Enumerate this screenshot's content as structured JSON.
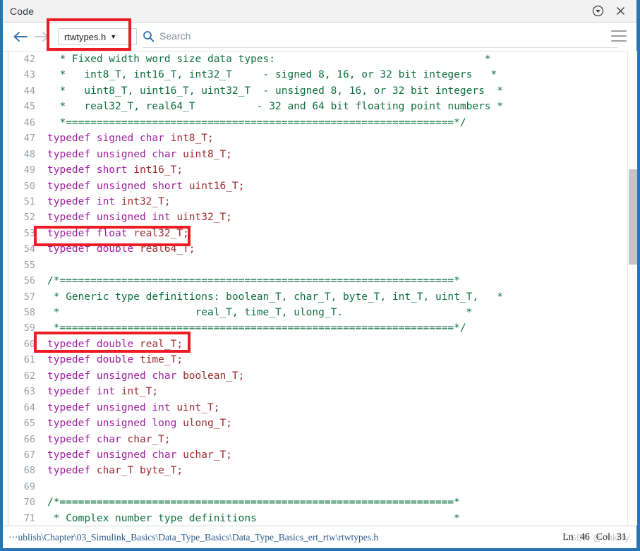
{
  "window": {
    "title": "Code",
    "undock_icon": "circle-down-arrow-icon",
    "close_icon": "close-icon"
  },
  "toolbar": {
    "back_icon": "arrow-left-icon",
    "forward_icon": "arrow-right-icon",
    "file_dropdown": {
      "value": "rtwtypes.h",
      "caret": "▼"
    },
    "search": {
      "icon": "search-icon",
      "placeholder": "Search",
      "value": ""
    },
    "menu_icon": "hamburger-menu-icon"
  },
  "editor": {
    "first_line": 42,
    "lines": [
      {
        "n": 42,
        "tokens": [
          {
            "t": "cm",
            "s": "  * Fixed width word size data types:                                  *"
          }
        ]
      },
      {
        "n": 43,
        "tokens": [
          {
            "t": "cm",
            "s": "  *   int8_T, int16_T, int32_T     - signed 8, 16, or 32 bit integers   *"
          }
        ]
      },
      {
        "n": 44,
        "tokens": [
          {
            "t": "cm",
            "s": "  *   uint8_T, uint16_T, uint32_T  - unsigned 8, 16, or 32 bit integers  *"
          }
        ]
      },
      {
        "n": 45,
        "tokens": [
          {
            "t": "cm",
            "s": "  *   real32_T, real64_T          - 32 and 64 bit floating point numbers *"
          }
        ]
      },
      {
        "n": 46,
        "tokens": [
          {
            "t": "cm",
            "s": "  *===============================================================*/"
          }
        ]
      },
      {
        "n": 47,
        "tokens": [
          {
            "t": "kw",
            "s": "typedef signed char "
          },
          {
            "t": "id",
            "s": "int8_T;"
          }
        ]
      },
      {
        "n": 48,
        "tokens": [
          {
            "t": "kw",
            "s": "typedef unsigned char "
          },
          {
            "t": "id",
            "s": "uint8_T;"
          }
        ]
      },
      {
        "n": 49,
        "tokens": [
          {
            "t": "kw",
            "s": "typedef short "
          },
          {
            "t": "id",
            "s": "int16_T;"
          }
        ]
      },
      {
        "n": 50,
        "tokens": [
          {
            "t": "kw",
            "s": "typedef unsigned short "
          },
          {
            "t": "id",
            "s": "uint16_T;"
          }
        ]
      },
      {
        "n": 51,
        "tokens": [
          {
            "t": "kw",
            "s": "typedef int "
          },
          {
            "t": "id",
            "s": "int32_T;"
          }
        ]
      },
      {
        "n": 52,
        "tokens": [
          {
            "t": "kw",
            "s": "typedef unsigned int "
          },
          {
            "t": "id",
            "s": "uint32_T;"
          }
        ]
      },
      {
        "n": 53,
        "tokens": [
          {
            "t": "kw",
            "s": "typedef float "
          },
          {
            "t": "id",
            "s": "real32_T;"
          }
        ]
      },
      {
        "n": 54,
        "tokens": [
          {
            "t": "kw",
            "s": "typedef double "
          },
          {
            "t": "id",
            "s": "real64_T;"
          }
        ]
      },
      {
        "n": 55,
        "tokens": [
          {
            "t": "cm",
            "s": ""
          }
        ]
      },
      {
        "n": 56,
        "tokens": [
          {
            "t": "cm",
            "s": "/*================================================================*"
          }
        ]
      },
      {
        "n": 57,
        "tokens": [
          {
            "t": "cm",
            "s": " * Generic type definitions: boolean_T, char_T, byte_T, int_T, uint_T,   *"
          }
        ]
      },
      {
        "n": 58,
        "tokens": [
          {
            "t": "cm",
            "s": " *                      real_T, time_T, ulong_T.                    *"
          }
        ]
      },
      {
        "n": 59,
        "tokens": [
          {
            "t": "cm",
            "s": " *================================================================*/"
          }
        ]
      },
      {
        "n": 60,
        "tokens": [
          {
            "t": "kw",
            "s": "typedef double "
          },
          {
            "t": "id",
            "s": "real_T;"
          }
        ]
      },
      {
        "n": 61,
        "tokens": [
          {
            "t": "kw",
            "s": "typedef double "
          },
          {
            "t": "id",
            "s": "time_T;"
          }
        ]
      },
      {
        "n": 62,
        "tokens": [
          {
            "t": "kw",
            "s": "typedef unsigned char "
          },
          {
            "t": "id",
            "s": "boolean_T;"
          }
        ]
      },
      {
        "n": 63,
        "tokens": [
          {
            "t": "kw",
            "s": "typedef int "
          },
          {
            "t": "id",
            "s": "int_T;"
          }
        ]
      },
      {
        "n": 64,
        "tokens": [
          {
            "t": "kw",
            "s": "typedef unsigned int "
          },
          {
            "t": "id",
            "s": "uint_T;"
          }
        ]
      },
      {
        "n": 65,
        "tokens": [
          {
            "t": "kw",
            "s": "typedef unsigned long "
          },
          {
            "t": "id",
            "s": "ulong_T;"
          }
        ]
      },
      {
        "n": 66,
        "tokens": [
          {
            "t": "kw",
            "s": "typedef char "
          },
          {
            "t": "id",
            "s": "char_T;"
          }
        ]
      },
      {
        "n": 67,
        "tokens": [
          {
            "t": "kw",
            "s": "typedef unsigned char "
          },
          {
            "t": "id",
            "s": "uchar_T;"
          }
        ]
      },
      {
        "n": 68,
        "tokens": [
          {
            "t": "kw",
            "s": "typedef "
          },
          {
            "t": "id",
            "s": "char_T byte_T;"
          }
        ]
      },
      {
        "n": 69,
        "tokens": [
          {
            "t": "cm",
            "s": ""
          }
        ]
      },
      {
        "n": 70,
        "tokens": [
          {
            "t": "cm",
            "s": "/*================================================================*"
          }
        ]
      },
      {
        "n": 71,
        "tokens": [
          {
            "t": "cm",
            "s": " * Complex number type definitions                                *"
          }
        ]
      }
    ]
  },
  "scrollbar": {
    "orientation": "vertical"
  },
  "statusbar": {
    "path": "···ublish\\Chapter\\03_Simulink_Basics\\Data_Type_Basics\\Data_Type_Basics_ert_rtw\\rtwtypes.h",
    "line_label": "Ln",
    "line_value": "46",
    "col_label": "Col",
    "col_value": "31",
    "watermark": "CSDN @chkilty"
  },
  "annotations": [
    {
      "name": "redbox-dropdown",
      "target": "file-dropdown"
    },
    {
      "name": "redbox-real32",
      "target": "line-53-typedef-float-real32_T"
    },
    {
      "name": "redbox-real",
      "target": "line-60-typedef-double-real_T"
    }
  ],
  "colors": {
    "accent_blue": "#2a74b5",
    "annotation_red": "#ec1c24",
    "keyword": "#a020a0",
    "identifier": "#9b2d30",
    "comment": "#0e7040",
    "line_number": "#9aa0a6"
  }
}
